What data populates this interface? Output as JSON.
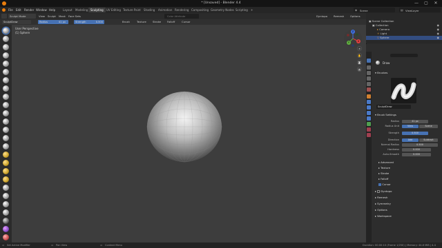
{
  "window": {
    "title": "* [Unsaved] - Blender 4.4",
    "controls": [
      "—",
      "▢",
      "✕"
    ]
  },
  "menubar": {
    "menus": [
      "File",
      "Edit",
      "Render",
      "Window",
      "Help"
    ],
    "tabs": [
      "Layout",
      "Modeling",
      "Sculpting",
      "UV Editing",
      "Texture Paint",
      "Shading",
      "Animation",
      "Rendering",
      "Compositing",
      "Geometry Nodes",
      "Scripting"
    ],
    "active_tab": "Sculpting",
    "add_tab": "+",
    "scene_label": "Scene",
    "viewlayer_label": "ViewLayer"
  },
  "viewport_header": {
    "mode": "Sculpt Mode",
    "menus": [
      "View",
      "Sculpt",
      "Mask",
      "Face Sets"
    ],
    "search_placeholder": "Color Attribute",
    "right_items": [
      "Dyntopo",
      "Remesh",
      "Options"
    ]
  },
  "tool_header": {
    "tool_name": "SculptDraw",
    "radius_label": "Radius",
    "radius_value": "41 px",
    "strength_label": "Strength",
    "strength_value": "0.500",
    "items": [
      "Brush",
      "Texture",
      "Stroke",
      "Falloff",
      "Cursor"
    ]
  },
  "viewport": {
    "perspective": "User Perspective",
    "object": "(1) Sphere",
    "axes": {
      "x": "X",
      "y": "Y",
      "z": "Z"
    }
  },
  "outliner": {
    "rows": [
      {
        "label": "Scene Collection",
        "indent": 0,
        "selected": false
      },
      {
        "label": "Collection",
        "indent": 1,
        "selected": false
      },
      {
        "label": "Camera",
        "indent": 2,
        "selected": false
      },
      {
        "label": "Light",
        "indent": 2,
        "selected": false
      },
      {
        "label": "Sphere",
        "indent": 2,
        "selected": true
      }
    ]
  },
  "properties": {
    "tool_title": "Draw",
    "brushes_label": "Brushes",
    "brush_name": "SculptDraw",
    "brush_settings_label": "Brush Settings",
    "rows": [
      {
        "label": "Radius",
        "value": "41 px"
      },
      {
        "label": "Radius Unit",
        "value": "View",
        "value2": "Scene"
      },
      {
        "label": "Strength",
        "value": "0.500"
      },
      {
        "label": "Direction",
        "value": "Add",
        "value2": "Subtract"
      },
      {
        "label": "Normal Radius",
        "value": "0.500"
      },
      {
        "label": "Hardness",
        "value": "0.000"
      },
      {
        "label": "Auto-Smooth",
        "value": "0.000"
      }
    ],
    "subsections": [
      "Advanced",
      "Texture",
      "Stroke",
      "Falloff",
      "Cursor"
    ],
    "sections": [
      "Dyntopo",
      "Remesh",
      "Symmetry",
      "Options",
      "Workspace"
    ]
  },
  "statusbar": {
    "left": "Set Active Modifier",
    "middle1": "Pan View",
    "middle2": "Context Menu",
    "right": "Duration: 00:00:10 (Frame 1/250) | Memory: 44.8 MiB | 4.4"
  },
  "colors": {
    "accent": "#4772b3",
    "viewport_bg": "#3d3d3d"
  }
}
